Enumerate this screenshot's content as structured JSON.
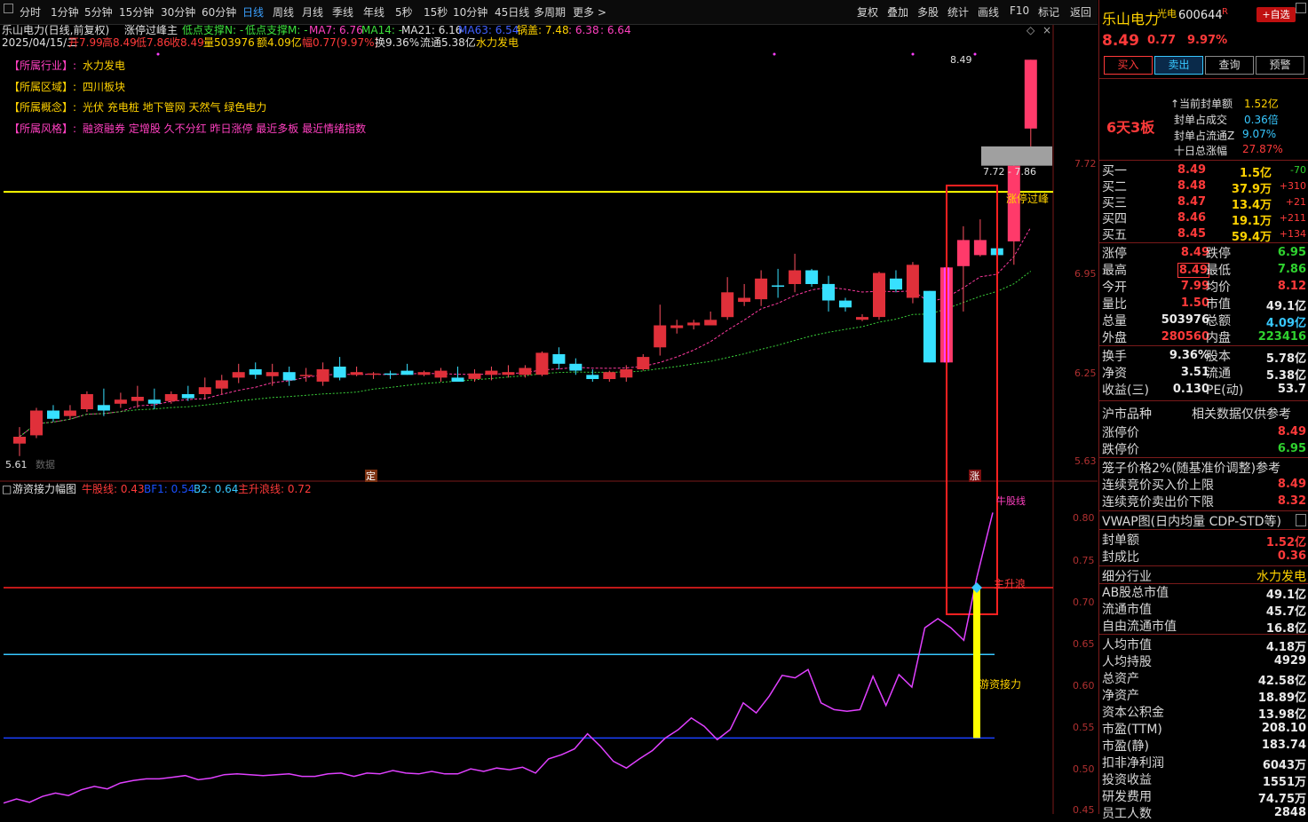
{
  "toolbar": {
    "items": [
      "分时",
      "1分钟",
      "5分钟",
      "15分钟",
      "30分钟",
      "60分钟",
      "日线",
      "周线",
      "月线",
      "季线",
      "年线",
      "5秒",
      "15秒",
      "10分钟",
      "45日线",
      "多周期",
      "更多 >"
    ],
    "active": "日线",
    "right_items": [
      "复权",
      "叠加",
      "多股",
      "统计",
      "画线",
      "F10",
      "标记",
      "返回"
    ]
  },
  "chart_header": {
    "title": "乐山电力(日线,前复权)",
    "indicator": "涨停过峰主",
    "low_support_n": "低点支撑N: -",
    "low_support_m": "低点支撑M: -",
    "ma7": "MA7: 6.76",
    "ma14": "MA14: -",
    "ma21": "MA21: 6.16",
    "ma63": "MA63: 6.54",
    "guo_gai": "锅盖: 7.48",
    "v1": ": 6.38",
    "v2": ": 6.64",
    "date_line": "2025/04/15/二",
    "open": "开7.99",
    "high": "高8.49",
    "low": "低7.86",
    "close": "收8.49",
    "vol": "量503976",
    "amount": "额4.09亿",
    "change": "幅0.77(9.97%)",
    "turnover": "换9.36%",
    "float_cap": "流通5.38亿",
    "sector_tag": "水力发电"
  },
  "info_lines": [
    {
      "label": "【所属行业】:",
      "value": "水力发电"
    },
    {
      "label": "【所属区域】:",
      "value": "四川板块"
    },
    {
      "label": "【所属概念】:",
      "value": "光伏 充电桩 地下管网 天然气 绿色电力"
    },
    {
      "label": "【所属风格】:",
      "value": "融资融券 定增股 久不分红 昨日涨停 最近多板 最近情绪指数"
    }
  ],
  "main_axis": [
    "7.72",
    "6.95",
    "6.25",
    "5.63"
  ],
  "annotations": {
    "high_label": "8.49",
    "gap_label": "7.72 - 7.86",
    "limit_peak": "涨停过峰",
    "low_label": "5.61",
    "bottom_text": "数据",
    "ding": "定",
    "zhang": "涨"
  },
  "sub_header": {
    "name": "游资接力幅图",
    "bull": "牛股线: 0.43",
    "bf1": "BF1: 0.54",
    "b2": "B2: 0.64",
    "main_rise": "主升浪线: 0.72"
  },
  "sub_axis": [
    "0.80",
    "0.75",
    "0.70",
    "0.65",
    "0.60",
    "0.55",
    "0.50",
    "0.45"
  ],
  "sub_labels": {
    "niu": "牛股线",
    "zsl": "主升浪",
    "yzjl": "游资接力"
  },
  "chart_data": {
    "type": "candlestick",
    "ohlc": [
      [
        5.7,
        5.82,
        5.61,
        5.75
      ],
      [
        5.76,
        5.96,
        5.74,
        5.94
      ],
      [
        5.94,
        5.98,
        5.86,
        5.88
      ],
      [
        5.9,
        5.98,
        5.88,
        5.94
      ],
      [
        5.95,
        6.08,
        5.93,
        6.06
      ],
      [
        5.98,
        6.1,
        5.9,
        5.94
      ],
      [
        5.99,
        6.07,
        5.96,
        6.02
      ],
      [
        6.01,
        6.12,
        5.96,
        6.04
      ],
      [
        6.02,
        6.1,
        5.95,
        5.99
      ],
      [
        6.01,
        6.08,
        5.99,
        6.06
      ],
      [
        6.06,
        6.12,
        6.01,
        6.03
      ],
      [
        6.06,
        6.18,
        6.02,
        6.11
      ],
      [
        6.1,
        6.2,
        6.06,
        6.16
      ],
      [
        6.18,
        6.28,
        6.14,
        6.22
      ],
      [
        6.24,
        6.29,
        6.17,
        6.2
      ],
      [
        6.19,
        6.28,
        6.12,
        6.22
      ],
      [
        6.22,
        6.26,
        6.12,
        6.16
      ],
      [
        6.19,
        6.25,
        6.15,
        6.2
      ],
      [
        6.15,
        6.29,
        6.12,
        6.24
      ],
      [
        6.26,
        6.33,
        6.16,
        6.18
      ],
      [
        6.2,
        6.26,
        6.19,
        6.22
      ],
      [
        6.2,
        6.22,
        6.17,
        6.21
      ],
      [
        6.21,
        6.23,
        6.17,
        6.2
      ],
      [
        6.23,
        6.28,
        6.2,
        6.2
      ],
      [
        6.2,
        6.23,
        6.19,
        6.22
      ],
      [
        6.18,
        6.25,
        6.15,
        6.23
      ],
      [
        6.18,
        6.26,
        6.15,
        6.15
      ],
      [
        6.17,
        6.24,
        6.15,
        6.21
      ],
      [
        6.2,
        6.26,
        6.16,
        6.23
      ],
      [
        6.2,
        6.27,
        6.18,
        6.22
      ],
      [
        6.2,
        6.27,
        6.18,
        6.25
      ],
      [
        6.2,
        6.37,
        6.19,
        6.36
      ],
      [
        6.35,
        6.4,
        6.24,
        6.28
      ],
      [
        6.28,
        6.32,
        6.2,
        6.23
      ],
      [
        6.2,
        6.24,
        6.15,
        6.17
      ],
      [
        6.17,
        6.23,
        6.15,
        6.22
      ],
      [
        6.18,
        6.27,
        6.15,
        6.24
      ],
      [
        6.24,
        6.35,
        6.23,
        6.33
      ],
      [
        6.4,
        6.71,
        6.34,
        6.56
      ],
      [
        6.54,
        6.6,
        6.5,
        6.56
      ],
      [
        6.56,
        6.6,
        6.53,
        6.58
      ],
      [
        6.56,
        6.66,
        6.56,
        6.6
      ],
      [
        6.62,
        6.91,
        6.6,
        6.8
      ],
      [
        6.73,
        6.86,
        6.7,
        6.76
      ],
      [
        6.75,
        6.96,
        6.7,
        6.9
      ],
      [
        6.85,
        6.97,
        6.76,
        6.84
      ],
      [
        6.86,
        7.08,
        6.8,
        6.96
      ],
      [
        6.96,
        6.97,
        6.84,
        6.86
      ],
      [
        6.86,
        6.92,
        6.66,
        6.74
      ],
      [
        6.74,
        6.76,
        6.66,
        6.69
      ],
      [
        6.6,
        6.64,
        6.59,
        6.62
      ],
      [
        6.62,
        6.95,
        6.6,
        6.94
      ],
      [
        6.9,
        6.96,
        6.8,
        6.82
      ],
      [
        6.76,
        7.02,
        6.72,
        7.0
      ],
      [
        6.81,
        6.81,
        6.29,
        6.29
      ],
      [
        6.29,
        6.98,
        6.29,
        6.98
      ],
      [
        6.99,
        7.28,
        6.66,
        7.18
      ],
      [
        7.07,
        7.33,
        7.06,
        7.18
      ],
      [
        7.12,
        7.32,
        7.04,
        7.07
      ],
      [
        7.17,
        7.73,
        7.0,
        7.72
      ],
      [
        7.99,
        8.49,
        7.86,
        8.49
      ]
    ],
    "sub_series": {
      "name": "游资接力",
      "values": [
        0.462,
        0.467,
        0.463,
        0.47,
        0.474,
        0.471,
        0.478,
        0.482,
        0.479,
        0.486,
        0.489,
        0.491,
        0.491,
        0.493,
        0.495,
        0.49,
        0.492,
        0.496,
        0.497,
        0.496,
        0.495,
        0.496,
        0.497,
        0.494,
        0.494,
        0.497,
        0.498,
        0.494,
        0.498,
        0.497,
        0.501,
        0.498,
        0.497,
        0.5,
        0.497,
        0.497,
        0.503,
        0.5,
        0.504,
        0.502,
        0.505,
        0.498,
        0.515,
        0.52,
        0.527,
        0.545,
        0.53,
        0.512,
        0.504,
        0.515,
        0.525,
        0.54,
        0.55,
        0.564,
        0.554,
        0.538,
        0.55,
        0.582,
        0.57,
        0.59,
        0.615,
        0.612,
        0.622,
        0.582,
        0.574,
        0.572,
        0.574,
        0.614,
        0.579,
        0.616,
        0.601,
        0.672,
        0.683,
        0.672,
        0.657,
        0.732
      ]
    },
    "ylim_main": [
      5.55,
      8.55
    ],
    "ylim_sub": [
      0.45,
      0.82
    ],
    "limit_up_price": 7.53,
    "sub_levels": {
      "bull": 0.43,
      "bf1": 0.54,
      "b2": 0.64,
      "main_rise": 0.72
    }
  },
  "right_panel": {
    "name": "乐山电力",
    "tag": "光电",
    "code": "600644",
    "r_badge": "R",
    "add_btn": "+自选",
    "price": "8.49",
    "change": "0.77",
    "pct": "9.97%",
    "buttons": [
      "买入",
      "卖出",
      "查询",
      "预警"
    ],
    "limit_days": "6天3板",
    "seal": [
      {
        "label": "↑当前封单额",
        "value": "1.52亿"
      },
      {
        "label": "封单占成交",
        "value": "0.36倍"
      },
      {
        "label": "封单占流通Z",
        "value": "9.07%"
      },
      {
        "label": "十日总涨幅",
        "value": "27.87%"
      }
    ],
    "bids": [
      {
        "label": "买一",
        "price": "8.49",
        "vol": "1.5亿",
        "chg": "-70"
      },
      {
        "label": "买二",
        "price": "8.48",
        "vol": "37.9万",
        "chg": "+310"
      },
      {
        "label": "买三",
        "price": "8.47",
        "vol": "13.4万",
        "chg": "+21"
      },
      {
        "label": "买四",
        "price": "8.46",
        "vol": "19.1万",
        "chg": "+211"
      },
      {
        "label": "买五",
        "price": "8.45",
        "vol": "59.4万",
        "chg": "+134"
      }
    ],
    "stats": [
      {
        "l1": "涨停",
        "v1": "8.49",
        "l2": "跌停",
        "v2": "6.95"
      },
      {
        "l1": "最高",
        "v1": "8.49",
        "l2": "最低",
        "v2": "7.86"
      },
      {
        "l1": "今开",
        "v1": "7.99",
        "l2": "均价",
        "v2": "8.12"
      },
      {
        "l1": "量比",
        "v1": "1.50",
        "l2": "市值",
        "v2": "49.1亿"
      },
      {
        "l1": "总量",
        "v1": "503976",
        "l2": "总额",
        "v2": "4.09亿"
      },
      {
        "l1": "外盘",
        "v1": "280560",
        "l2": "内盘",
        "v2": "223416"
      }
    ],
    "stats2": [
      {
        "l1": "换手",
        "v1": "9.36%",
        "l2": "股本",
        "v2": "5.78亿"
      },
      {
        "l1": "净资",
        "v1": "3.51",
        "l2": "流通",
        "v2": "5.38亿"
      },
      {
        "l1": "收益(三)",
        "v1": "0.130",
        "l2": "PE(动)",
        "v2": "53.7"
      }
    ],
    "market_type": "沪市品种",
    "market_note": "相关数据仅供参考",
    "limit_prices": [
      {
        "label": "涨停价",
        "value": "8.49"
      },
      {
        "label": "跌停价",
        "value": "6.95"
      }
    ],
    "cage_title": "笼子价格2%(随基准价调整)参考",
    "cage": [
      {
        "label": "连续竞价买入价上限",
        "value": "8.49"
      },
      {
        "label": "连续竞价卖出价下限",
        "value": "8.32"
      }
    ],
    "vwap": "VWAP图(日内均量 CDP-STD等)",
    "seal2": [
      {
        "label": "封单额",
        "value": "1.52亿"
      },
      {
        "label": "封成比",
        "value": "0.36"
      }
    ],
    "industry_label": "细分行业",
    "industry_value": "水力发电",
    "funds": [
      {
        "label": "AB股总市值",
        "value": "49.1亿"
      },
      {
        "label": "流通市值",
        "value": "45.7亿"
      },
      {
        "label": "自由流通市值",
        "value": "16.8亿"
      }
    ],
    "fund2": [
      {
        "label": "人均市值",
        "value": "4.18万"
      },
      {
        "label": "人均持股",
        "value": "4929"
      },
      {
        "label": "总资产",
        "value": "42.58亿"
      },
      {
        "label": "净资产",
        "value": "18.89亿"
      },
      {
        "label": "资本公积金",
        "value": "13.98亿"
      },
      {
        "label": "市盈(TTM)",
        "value": "208.10"
      },
      {
        "label": "市盈(静)",
        "value": "183.74"
      },
      {
        "label": "扣非净利润",
        "value": "6043万"
      },
      {
        "label": "投资收益",
        "value": "1551万"
      },
      {
        "label": "研发费用",
        "value": "74.75万"
      },
      {
        "label": "员工人数",
        "value": "2848"
      }
    ]
  }
}
